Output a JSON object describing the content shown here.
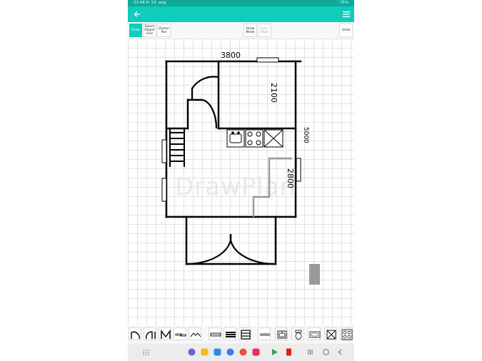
{
  "status_bar": {
    "time_date": "22:46  Fr 13. aug",
    "battery": "75%"
  },
  "app_bar": {
    "back_icon": "arrow-left-icon",
    "menu_icon": "hamburger-menu-icon"
  },
  "toolbar": {
    "draw": "Draw",
    "select": "Select Object Line",
    "zoom": "Zoom/ Pan",
    "draw_mode": "Draw Mode",
    "dele": "Dele / Walls",
    "undo": "Undo"
  },
  "plan": {
    "dim_top": "3800",
    "dim_right_upper": "2100",
    "dim_right_total": "5000",
    "dim_right_lower": "2800",
    "watermark": "DrawPlan"
  },
  "palette": [
    "single-door-icon",
    "double-door-icon",
    "arch-door-icon",
    "sliding-door-icon",
    "bay-window-icon",
    "window-icon",
    "thick-wall-icon",
    "stairs-icon",
    "grey-wall-icon",
    "sink-icon",
    "stove-icon",
    "toilet-icon",
    "bathtub-icon",
    "box-cross-icon",
    "cooktop-icon"
  ],
  "nav_apps": [
    "apps-grid-icon",
    "galaxy-icon",
    "notes-icon",
    "calendar-icon",
    "messages-icon",
    "camera-icon",
    "youtube-icon",
    "play-store-icon",
    "pdf-icon",
    "recent-apps-icon",
    "home-icon",
    "back-icon"
  ],
  "colors": {
    "accent": "#10cdb9",
    "status": "#11a99a",
    "wall": "#000000"
  }
}
